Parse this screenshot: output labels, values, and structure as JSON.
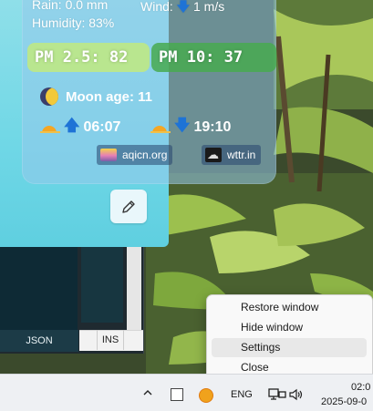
{
  "weather": {
    "rain": "Rain: 0.0 mm",
    "wind_label": "Wind:",
    "wind_dir_icon": "arrow-down-icon",
    "wind_value": "1 m/s",
    "humidity": "Humidity: 83%",
    "pm25": "PM 2.5: 82",
    "pm10": "PM 10: 37",
    "moon_age": "Moon age: 11",
    "sunrise": "06:07",
    "sunset": "19:10",
    "sources": [
      {
        "label": "aqicn.org",
        "icon": "aqicn-icon"
      },
      {
        "label": "wttr.in",
        "icon": "wttr-icon"
      }
    ],
    "colors": {
      "pm25": "#c4eb78",
      "pm10": "#48aa50",
      "arrow": "#1e73d6"
    }
  },
  "editor": {
    "json_label": "JSON",
    "ins_label": "INS"
  },
  "context_menu": {
    "items": [
      "Restore window",
      "Hide window",
      "Settings",
      "Close"
    ],
    "highlighted": "Settings"
  },
  "taskbar": {
    "language": "ENG",
    "time": "02:0",
    "date": "2025-09-0"
  }
}
